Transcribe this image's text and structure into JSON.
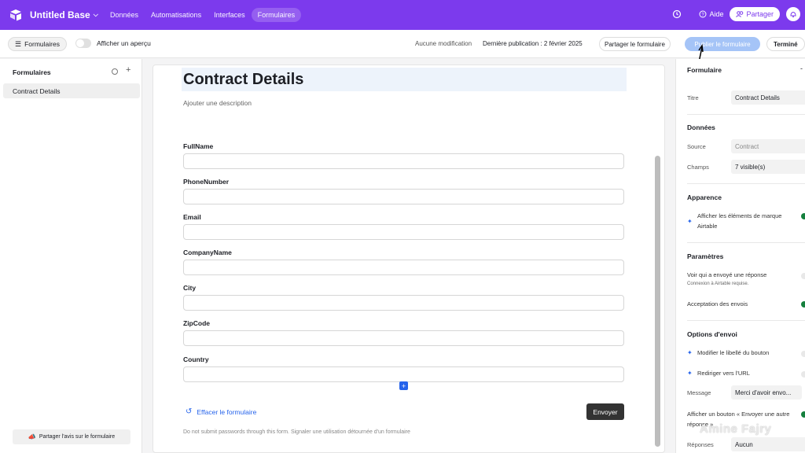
{
  "topbar": {
    "base_title": "Untitled Base",
    "nav": [
      "Données",
      "Automatisations",
      "Interfaces",
      "Formulaires"
    ],
    "active_nav": "Formulaires",
    "help_label": "Aide",
    "share_label": "Partager",
    "accent": "#7c3aed"
  },
  "toolbar": {
    "forms_label": "Formulaires",
    "preview_label": "Afficher un aperçu",
    "status": "Aucune modification",
    "published": "Dernière publication : 2 février 2025",
    "share_form": "Partager le formulaire",
    "publish_form": "Publier le formulaire",
    "done": "Terminé"
  },
  "sidebar": {
    "title": "Formulaires",
    "items": [
      "Contract Details"
    ],
    "feedback": "Partager l'avis sur le formulaire"
  },
  "form": {
    "title": "Contract Details",
    "description_placeholder": "Ajouter une description",
    "fields": [
      "FullName",
      "PhoneNumber",
      "Email",
      "CompanyName",
      "City",
      "ZipCode",
      "Country"
    ],
    "clear_label": "Effacer le formulaire",
    "submit_label": "Envoyer",
    "disclaimer": "Do not submit passwords through this form. Signaler une utilisation détournée d'un formulaire"
  },
  "panel": {
    "header": "Formulaire",
    "title_label": "Titre",
    "title_value": "Contract Details",
    "data_header": "Données",
    "source_label": "Source",
    "source_value": "Contract",
    "fields_label": "Champs",
    "fields_value": "7 visible(s)",
    "appearance_header": "Apparence",
    "branding_label": "Afficher les éléments de marque Airtable",
    "settings_header": "Paramètres",
    "see_who_label": "Voir qui a envoyé une réponse",
    "see_who_sub": "Connexion à Airtable requise.",
    "accept_label": "Acceptation des envois",
    "submit_options_header": "Options d'envoi",
    "modify_button_label": "Modifier le libellé du bouton",
    "redirect_label": "Rediriger vers l'URL",
    "message_label": "Message",
    "message_value": "Merci d'avoir envo...",
    "show_button_label": "Afficher un bouton « Envoyer une autre réponse »",
    "responses_label": "Réponses",
    "responses_value": "Aucun"
  },
  "watermark": "Amine Fajry"
}
